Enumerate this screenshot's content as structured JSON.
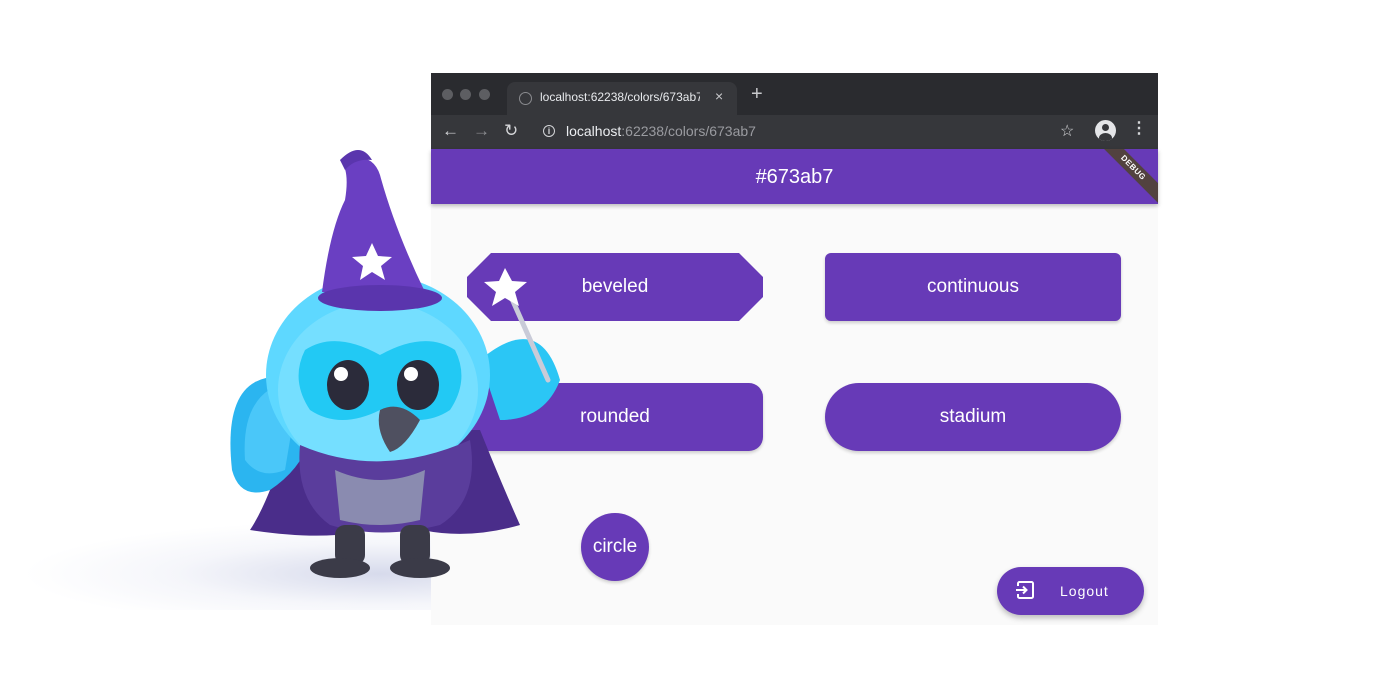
{
  "browser": {
    "tab_title": "localhost:62238/colors/673ab7",
    "tab_close": "×",
    "new_tab": "+",
    "url_host": "localhost",
    "url_rest": ":62238/colors/673ab7"
  },
  "app": {
    "title": "#673ab7",
    "accent_color": "#673ab7",
    "debug_banner": "DEBUG",
    "buttons": {
      "beveled": "beveled",
      "continuous": "continuous",
      "rounded": "rounded",
      "stadium": "stadium",
      "circle": "circle"
    },
    "logout_label": "Logout"
  },
  "icons": [
    "back-arrow-icon",
    "forward-arrow-icon",
    "reload-icon",
    "info-icon",
    "bookmark-star-icon",
    "profile-icon",
    "more-vert-icon",
    "logout-icon"
  ]
}
